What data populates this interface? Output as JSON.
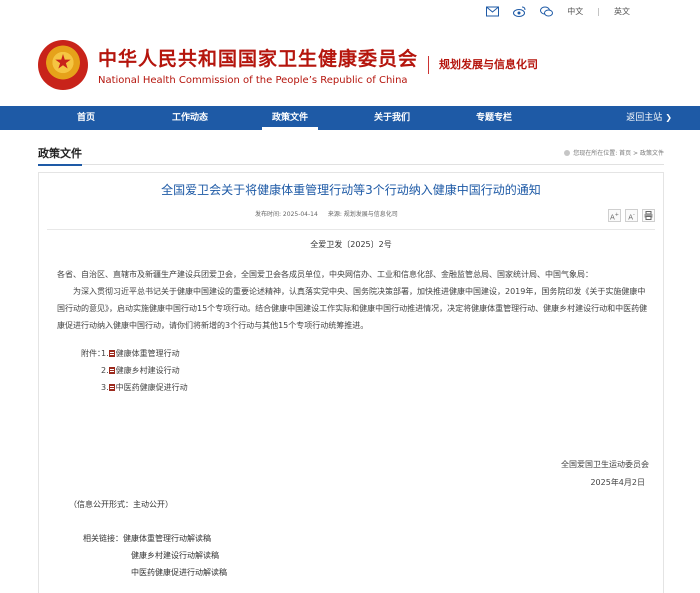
{
  "util": {
    "lang_cn": "中文",
    "lang_en": "英文"
  },
  "header": {
    "title_cn": "中华人民共和国国家卫生健康委员会",
    "title_en": "National Health Commission of the People’s Republic of China",
    "department": "规划发展与信息化司"
  },
  "nav": {
    "items": [
      "首页",
      "工作动态",
      "政策文件",
      "关于我们",
      "专题专栏"
    ],
    "active_index": 2,
    "back_label": "返回主站"
  },
  "section": {
    "title": "政策文件",
    "breadcrumb": "您现在所在位置: 首页 > 政策文件"
  },
  "article": {
    "title": "全国爱卫会关于将健康体重管理行动等3个行动纳入健康中国行动的通知",
    "publish_label": "发布时间: 2025-04-14",
    "source_label": "来源: 规划发展与信息化司",
    "doc_number": "全爱卫发〔2025〕2号",
    "salutation": "各省、自治区、直辖市及新疆生产建设兵团爱卫会，全国爱卫会各成员单位，中央网信办、工业和信息化部、金融监管总局、国家统计局、中国气象局：",
    "paragraph": "为深入贯彻习近平总书记关于健康中国建设的重要论述精神，认真落实党中央、国务院决策部署，加快推进健康中国建设，2019年，国务院印发《关于实施健康中国行动的意见》，启动实施健康中国行动15个专项行动。结合健康中国建设工作实际和健康中国行动推进情况，决定将健康体重管理行动、健康乡村建设行动和中医药健康促进行动纳入健康中国行动，请你们将新增的3个行动与其他15个专项行动统筹推进。",
    "attachment_label": "附件：",
    "attachments": [
      {
        "num": "1.",
        "name": "健康体重管理行动"
      },
      {
        "num": "2.",
        "name": "健康乡村建设行动"
      },
      {
        "num": "3.",
        "name": "中医药健康促进行动"
      }
    ],
    "signatory": "全国爱国卫生运动委员会",
    "date": "2025年4月2日",
    "open_form": "（信息公开形式：主动公开）",
    "related_label": "相关链接：",
    "related_links": [
      "健康体重管理行动解读稿",
      "健康乡村建设行动解读稿",
      "中医药健康促进行动解读稿"
    ]
  }
}
